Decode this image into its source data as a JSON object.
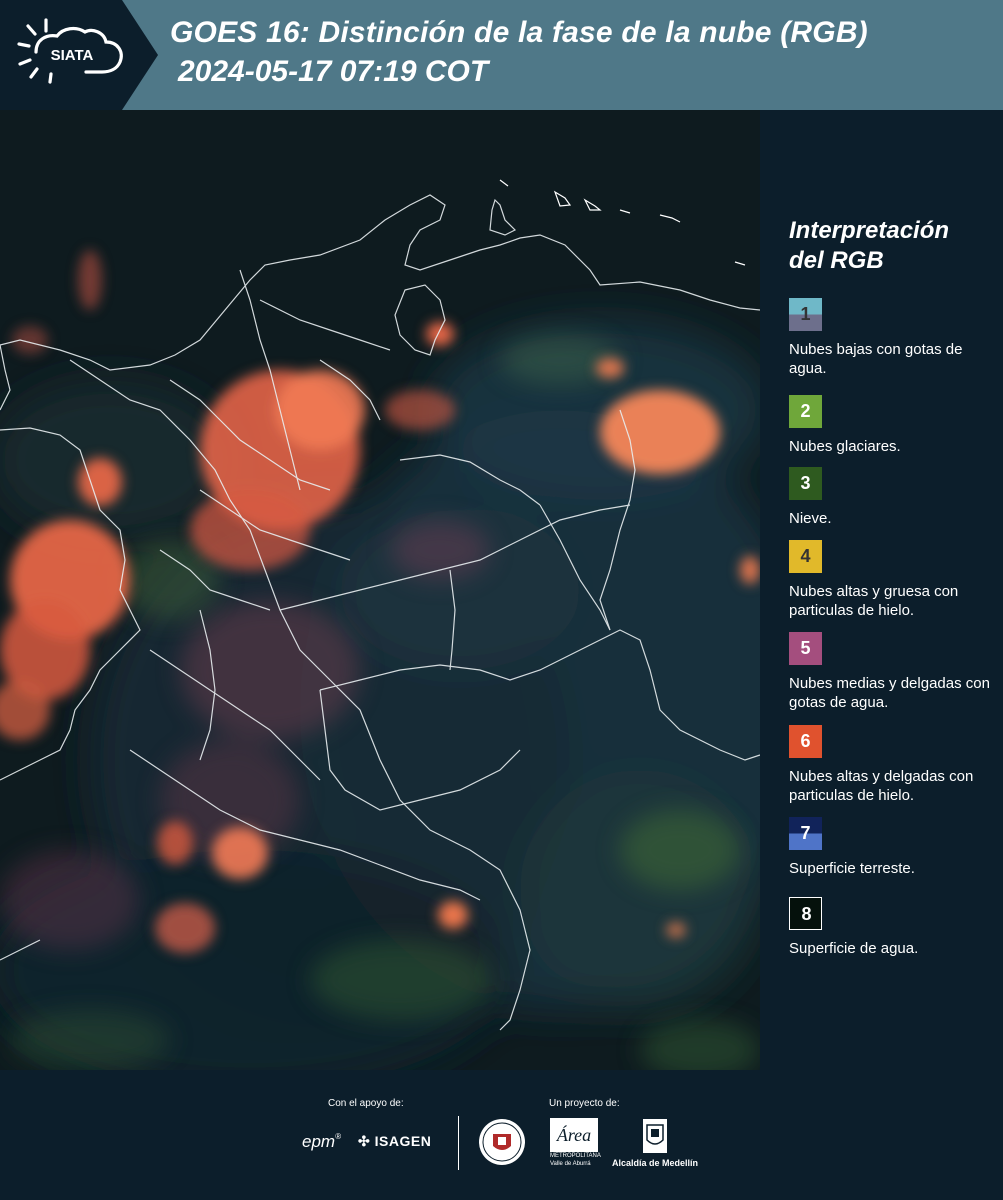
{
  "header": {
    "logo_text": "SIATA",
    "title_line1": "GOES 16: Distinción de la fase de la nube (RGB)",
    "title_line2": "2024-05-17 07:19 COT"
  },
  "legend": {
    "title": "Interpretación del RGB",
    "items": [
      {
        "number": "1",
        "label": "Nubes bajas con gotas de agua.",
        "colors": [
          "#6fb8c8",
          "#6d6f8c"
        ],
        "num_color": "#333333"
      },
      {
        "number": "2",
        "label": "Nubes glaciares.",
        "colors": [
          "#6fa73a"
        ],
        "num_color": "#ffffff"
      },
      {
        "number": "3",
        "label": "Nieve.",
        "colors": [
          "#2e5a1f"
        ],
        "num_color": "#ffffff"
      },
      {
        "number": "4",
        "label": "Nubes altas y gruesa con particulas de hielo.",
        "colors": [
          "#e1b92a"
        ],
        "num_color": "#333333"
      },
      {
        "number": "5",
        "label": "Nubes medias y delgadas con gotas de agua.",
        "colors": [
          "#a44e7e"
        ],
        "num_color": "#ffffff"
      },
      {
        "number": "6",
        "label": "Nubes altas y delgadas con particulas de hielo.",
        "colors": [
          "#e0522e"
        ],
        "num_color": "#ffffff"
      },
      {
        "number": "7",
        "label": "Superficie terreste.",
        "colors": [
          "#11235a",
          "#4f74c8"
        ],
        "num_color": "#ffffff"
      },
      {
        "number": "8",
        "label": "Superficie de agua.",
        "colors": [
          "#05110c"
        ],
        "num_color": "#ffffff"
      }
    ]
  },
  "footer": {
    "support_caption": "Con el apoyo de:",
    "project_caption": "Un proyecto de:",
    "epm": "epm",
    "isagen": "ISAGEN",
    "metropolitana": "METROPOLITANA",
    "metro_sub": "Valle de Aburrá",
    "alcaldia": "Alcaldía de Medellín"
  }
}
